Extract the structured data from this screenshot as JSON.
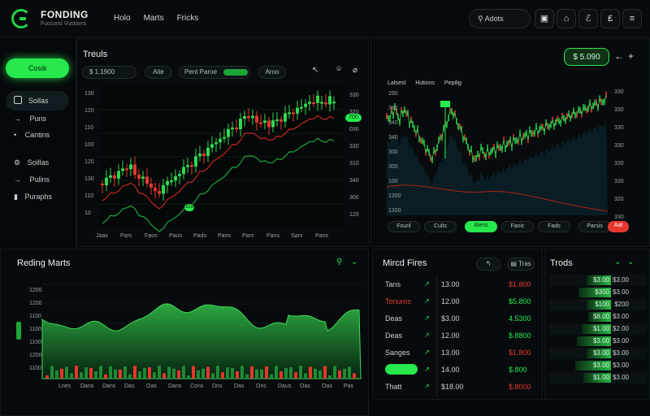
{
  "app": {
    "brand": "FONDING",
    "brand_sub": "Fuccorid Vustoers"
  },
  "nav": [
    "Holo",
    "Marts",
    "Fricks"
  ],
  "search": {
    "label": "Adots"
  },
  "toolbar_icons": [
    "calendar-icon",
    "home-icon",
    "wrench-icon",
    "dollar-icon",
    "menu-icon"
  ],
  "sidebar": {
    "primary_button": "Cosik",
    "items": [
      {
        "label": "Sollas",
        "icon": "square-icon"
      },
      {
        "label": "Puns",
        "icon": "arrow-icon"
      },
      {
        "label": "Cantins",
        "icon": "circle-icon"
      },
      {
        "label": "Soillas",
        "icon": "gear-icon"
      },
      {
        "label": "Pulins",
        "icon": "arrow-icon"
      },
      {
        "label": "Puraphs",
        "icon": "bar-icon"
      }
    ]
  },
  "main_chart": {
    "title": "Treuls",
    "value_field": "$ 1.1900",
    "controls": [
      "Aite",
      "Pent Paroe",
      "Aroo"
    ],
    "y_ticks": [
      "130",
      "120",
      "110",
      "100",
      "120",
      "130",
      "110",
      "10"
    ],
    "right_ticks": [
      "330",
      "320",
      "030",
      "330",
      "310",
      "340",
      "300",
      "120"
    ],
    "x_ticks": [
      "Jaas",
      "Pars",
      "Faos",
      "Paus",
      "Pads",
      "Pans",
      "Pars",
      "Pans",
      "Sars",
      "Pans"
    ],
    "badge_top": "700",
    "badge_mid": "320",
    "badge_low": "333"
  },
  "right_chart": {
    "value": "$ 5.090",
    "legend": [
      "Latsesl",
      "Hutions",
      "Pepilig"
    ],
    "y_left": [
      "290",
      "380",
      "340",
      "340",
      "300",
      "300",
      "100",
      "1200",
      "1200"
    ],
    "y_right": [
      "330",
      "330",
      "330",
      "330",
      "330",
      "330",
      "320",
      "330"
    ],
    "buttons": [
      "Fouril",
      "Cults",
      "Aleris",
      "Fanic",
      "Fads",
      "Parsis",
      "Aat"
    ]
  },
  "rising": {
    "title": "Reding Marts",
    "y_ticks": [
      "1200",
      "1200",
      "1100",
      "1100",
      "1100",
      "1200",
      "1100"
    ],
    "x_ticks": [
      "Lnes",
      "Dans",
      "Dans",
      "Das",
      "Oas",
      "Dans",
      "Cons",
      "Dns",
      "Das",
      "Ons",
      "Daus",
      "Oas",
      "Oas",
      "Pas"
    ]
  },
  "fixed": {
    "title": "Mircd Fires",
    "tab": "Tras",
    "rows": [
      {
        "name": "Tans",
        "mid": "13.00",
        "val": "$1.800",
        "name_color": "#c9d1cc",
        "val_color": "#e6372d"
      },
      {
        "name": "Tonuros",
        "mid": "12.00",
        "val": "$5.800",
        "name_color": "#e6372d",
        "val_color": "#27e84d"
      },
      {
        "name": "Deas",
        "mid": "$3.00",
        "val": "4.5300",
        "name_color": "#c9d1cc",
        "val_color": "#27e84d"
      },
      {
        "name": "Deas",
        "mid": "12.00",
        "val": "$.8800",
        "name_color": "#c9d1cc",
        "val_color": "#27e84d"
      },
      {
        "name": "Sanges",
        "mid": "13.00",
        "val": "$1.800",
        "name_color": "#c9d1cc",
        "val_color": "#e6372d"
      },
      {
        "name": "",
        "mid": "14.00",
        "val": "$.800",
        "name_color": "#c9d1cc",
        "val_color": "#27e84d"
      },
      {
        "name": "Thatt",
        "mid": "$18.00",
        "val": "$.8000",
        "name_color": "#c9d1cc",
        "val_color": "#e6372d"
      }
    ]
  },
  "trends": {
    "title": "Trods",
    "rows": [
      {
        "label": "$3.00",
        "val": "$3,00"
      },
      {
        "label": "$300",
        "val": "$3.00"
      },
      {
        "label": "$100",
        "val": "$200"
      },
      {
        "label": "$8.00",
        "val": "$3.00"
      },
      {
        "label": "$1.00",
        "val": "$2.00"
      },
      {
        "label": "$3.00",
        "val": "$3.00"
      },
      {
        "label": "$3.00",
        "val": "$3.00"
      },
      {
        "label": "$3.00",
        "val": "$3.00"
      },
      {
        "label": "$1.00",
        "val": "$3.00"
      }
    ]
  },
  "colors": {
    "accent": "#27e84d",
    "down": "#e6372d",
    "bg": "#05080a"
  }
}
